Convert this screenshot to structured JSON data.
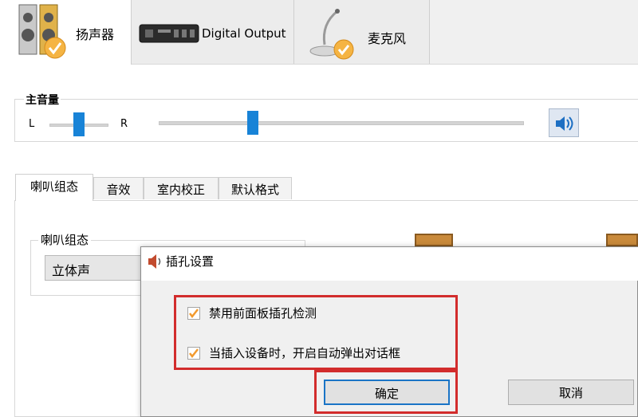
{
  "device_tabs": [
    {
      "label": "扬声器",
      "icon": "speaker-icon"
    },
    {
      "label": "Digital Output",
      "icon": "digital-output-icon"
    },
    {
      "label": "麦克风",
      "icon": "microphone-icon"
    }
  ],
  "master_volume": {
    "title": "主音量",
    "left_label": "L",
    "right_label": "R",
    "balance": 0.5,
    "level": 0.25
  },
  "config_tabs": [
    "喇叭组态",
    "音效",
    "室内校正",
    "默认格式"
  ],
  "speaker_config": {
    "group_title": "喇叭组态",
    "selected": "立体声"
  },
  "dialog": {
    "title": "插孔设置",
    "options": [
      {
        "label": "禁用前面板插孔检测",
        "checked": true
      },
      {
        "label": "当插入设备时，开启自动弹出对话框",
        "checked": true
      }
    ],
    "ok_label": "确定",
    "cancel_label": "取消"
  },
  "colors": {
    "accent": "#1883d7",
    "highlight_red": "#d22c2c",
    "checkmark": "#f29a2e"
  }
}
